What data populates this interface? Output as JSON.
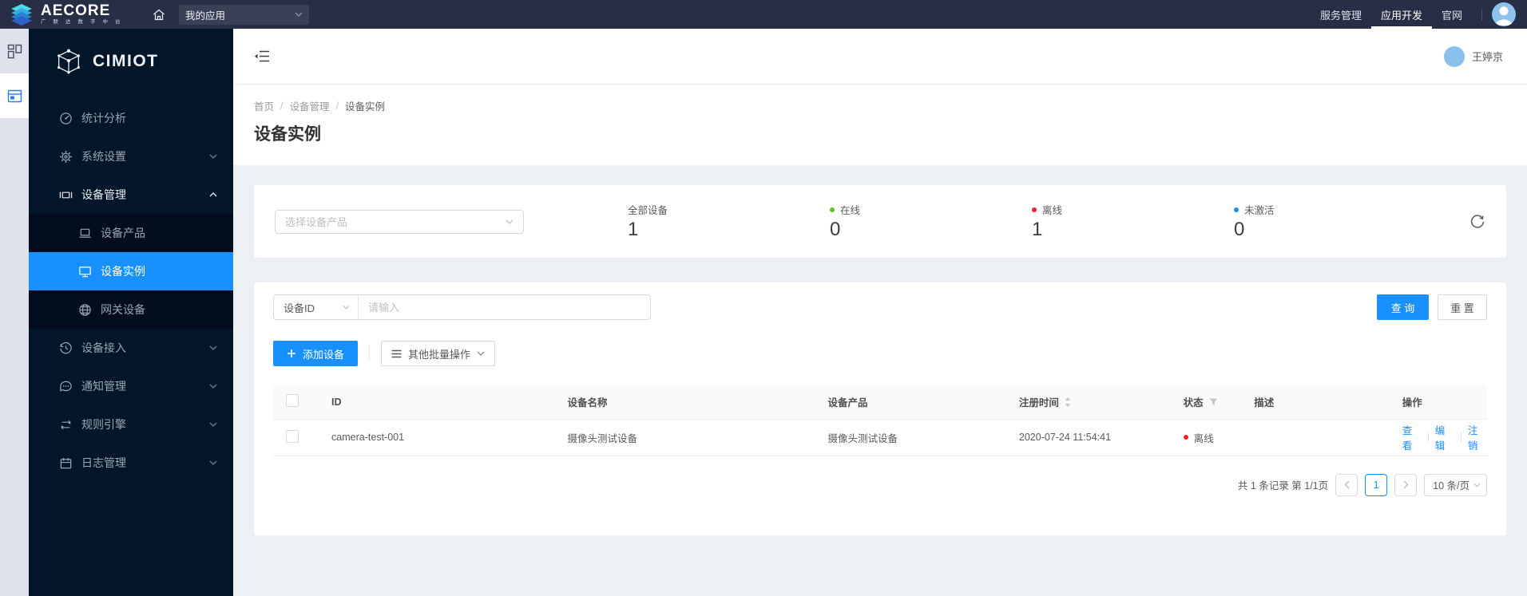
{
  "topbar": {
    "brand_name": "AECORE",
    "brand_subtitle": "广 联 达 数 字 中 台",
    "app_select_value": "我的应用",
    "nav": [
      {
        "label": "服务管理",
        "active": false
      },
      {
        "label": "应用开发",
        "active": true
      },
      {
        "label": "官网",
        "active": false
      }
    ]
  },
  "sidebar": {
    "product": "CIMIOT",
    "menu": [
      {
        "label": "统计分析",
        "icon": "gauge-icon"
      },
      {
        "label": "系统设置",
        "icon": "gear-icon",
        "expandable": true
      },
      {
        "label": "设备管理",
        "icon": "device-manage-icon",
        "expandable": true,
        "expanded": true,
        "children": [
          {
            "label": "设备产品",
            "icon": "laptop-icon"
          },
          {
            "label": "设备实例",
            "icon": "monitor-icon",
            "selected": true
          },
          {
            "label": "网关设备",
            "icon": "globe-icon"
          }
        ]
      },
      {
        "label": "设备接入",
        "icon": "history-icon",
        "expandable": true
      },
      {
        "label": "通知管理",
        "icon": "message-icon",
        "expandable": true
      },
      {
        "label": "规则引擎",
        "icon": "rule-icon",
        "expandable": true
      },
      {
        "label": "日志管理",
        "icon": "calendar-icon",
        "expandable": true
      }
    ]
  },
  "header": {
    "user_name": "王婷京"
  },
  "breadcrumb": {
    "items": [
      "首页",
      "设备管理",
      "设备实例"
    ],
    "separator": "/"
  },
  "page": {
    "title": "设备实例"
  },
  "stats": {
    "product_select_placeholder": "选择设备产品",
    "items": [
      {
        "label": "全部设备",
        "value": "1",
        "dot_color": null
      },
      {
        "label": "在线",
        "value": "0",
        "dot_color": "#52c41a"
      },
      {
        "label": "离线",
        "value": "1",
        "dot_color": "#f5222d"
      },
      {
        "label": "未激活",
        "value": "0",
        "dot_color": "#1890ff"
      }
    ]
  },
  "filters": {
    "field_select_value": "设备ID",
    "input_placeholder": "请输入",
    "search_label": "查 询",
    "reset_label": "重 置"
  },
  "actions": {
    "add_label": "添加设备",
    "batch_label": "其他批量操作"
  },
  "table": {
    "columns": [
      "ID",
      "设备名称",
      "设备产品",
      "注册时间",
      "状态",
      "描述",
      "操作"
    ],
    "rows": [
      {
        "id": "camera-test-001",
        "name": "摄像头测试设备",
        "product": "摄像头测试设备",
        "registered": "2020-07-24 11:54:41",
        "status": "离线",
        "status_color": "#f5222d",
        "desc": "",
        "actions": [
          "查看",
          "编辑",
          "注销"
        ]
      }
    ]
  },
  "pagination": {
    "summary": "共 1 条记录 第 1/1页",
    "current_page": "1",
    "page_size": "10 条/页"
  },
  "colors": {
    "accent": "#1890ff",
    "online": "#52c41a",
    "offline": "#f5222d",
    "not_activated": "#1890ff",
    "topbar_bg": "#272e45",
    "sidebar_bg": "#031528"
  }
}
